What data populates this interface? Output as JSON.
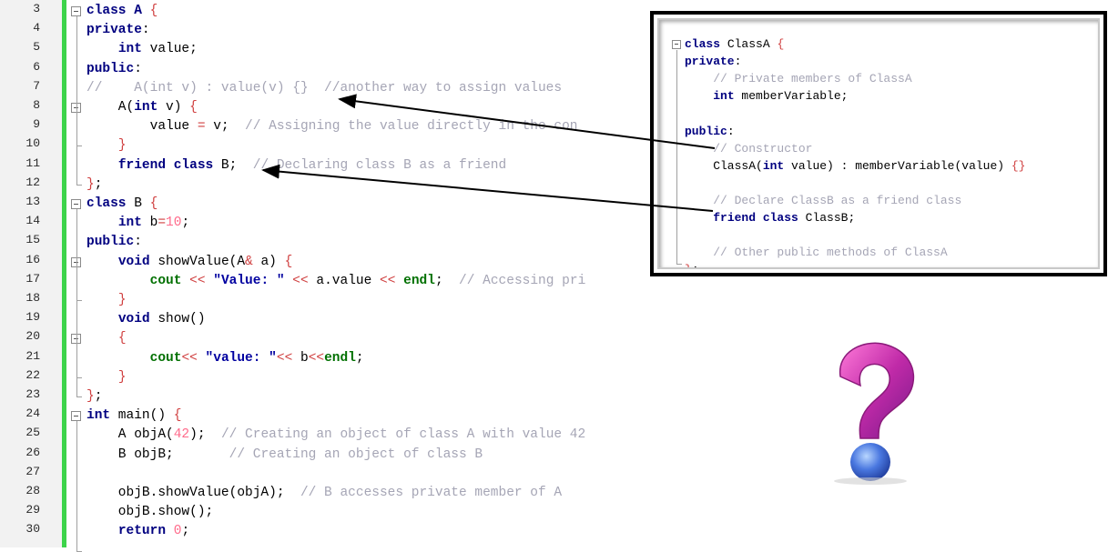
{
  "editor": {
    "line_numbers": [
      "3",
      "4",
      "5",
      "6",
      "7",
      "8",
      "9",
      "10",
      "11",
      "12",
      "13",
      "14",
      "15",
      "16",
      "17",
      "18",
      "19",
      "20",
      "21",
      "22",
      "23",
      "24",
      "25",
      "26",
      "27",
      "28",
      "29",
      "30"
    ],
    "lines": [
      [
        {
          "t": "class A ",
          "c": "kw"
        },
        {
          "t": "{",
          "c": "br"
        }
      ],
      [
        {
          "t": "private",
          "c": "kw"
        },
        {
          "t": ":",
          "c": ""
        }
      ],
      [
        {
          "t": "    ",
          "c": ""
        },
        {
          "t": "int",
          "c": "kw"
        },
        {
          "t": " value;",
          "c": ""
        }
      ],
      [
        {
          "t": "public",
          "c": "kw"
        },
        {
          "t": ":",
          "c": ""
        }
      ],
      [
        {
          "t": "//    A(int v) : value(v) {}  //another way to assign values",
          "c": "cm"
        }
      ],
      [
        {
          "t": "    A(",
          "c": ""
        },
        {
          "t": "int",
          "c": "kw"
        },
        {
          "t": " v) ",
          "c": ""
        },
        {
          "t": "{",
          "c": "br"
        }
      ],
      [
        {
          "t": "        value ",
          "c": ""
        },
        {
          "t": "=",
          "c": "op"
        },
        {
          "t": " v;  ",
          "c": ""
        },
        {
          "t": "// Assigning the value directly in the con",
          "c": "cm"
        }
      ],
      [
        {
          "t": "    ",
          "c": ""
        },
        {
          "t": "}",
          "c": "br"
        }
      ],
      [
        {
          "t": "    ",
          "c": ""
        },
        {
          "t": "friend class",
          "c": "kw"
        },
        {
          "t": " B;  ",
          "c": ""
        },
        {
          "t": "// Declaring class B as a friend",
          "c": "cm"
        }
      ],
      [
        {
          "t": "}",
          "c": "br"
        },
        {
          "t": ";",
          "c": ""
        }
      ],
      [
        {
          "t": "class",
          "c": "kw"
        },
        {
          "t": " B ",
          "c": ""
        },
        {
          "t": "{",
          "c": "br"
        }
      ],
      [
        {
          "t": "    ",
          "c": ""
        },
        {
          "t": "int",
          "c": "kw"
        },
        {
          "t": " b",
          "c": ""
        },
        {
          "t": "=",
          "c": "op"
        },
        {
          "t": "10",
          "c": "num"
        },
        {
          "t": ";",
          "c": ""
        }
      ],
      [
        {
          "t": "public",
          "c": "kw"
        },
        {
          "t": ":",
          "c": ""
        }
      ],
      [
        {
          "t": "    ",
          "c": ""
        },
        {
          "t": "void",
          "c": "kw"
        },
        {
          "t": " showValue(A",
          "c": ""
        },
        {
          "t": "&",
          "c": "op"
        },
        {
          "t": " a) ",
          "c": ""
        },
        {
          "t": "{",
          "c": "br"
        }
      ],
      [
        {
          "t": "        ",
          "c": ""
        },
        {
          "t": "cout",
          "c": "fn"
        },
        {
          "t": " << ",
          "c": "op"
        },
        {
          "t": "\"Value: \"",
          "c": "str"
        },
        {
          "t": " << ",
          "c": "op"
        },
        {
          "t": "a.value ",
          "c": ""
        },
        {
          "t": "<<",
          "c": "op"
        },
        {
          "t": " endl",
          "c": "fn"
        },
        {
          "t": ";  ",
          "c": ""
        },
        {
          "t": "// Accessing pri",
          "c": "cm"
        }
      ],
      [
        {
          "t": "    ",
          "c": ""
        },
        {
          "t": "}",
          "c": "br"
        }
      ],
      [
        {
          "t": "    ",
          "c": ""
        },
        {
          "t": "void",
          "c": "kw"
        },
        {
          "t": " show()",
          "c": ""
        }
      ],
      [
        {
          "t": "    ",
          "c": ""
        },
        {
          "t": "{",
          "c": "br"
        }
      ],
      [
        {
          "t": "        ",
          "c": ""
        },
        {
          "t": "cout",
          "c": "fn"
        },
        {
          "t": "<< ",
          "c": "op"
        },
        {
          "t": "\"value: \"",
          "c": "str"
        },
        {
          "t": "<<",
          "c": "op"
        },
        {
          "t": " b",
          "c": ""
        },
        {
          "t": "<<",
          "c": "op"
        },
        {
          "t": "endl",
          "c": "fn"
        },
        {
          "t": ";",
          "c": ""
        }
      ],
      [
        {
          "t": "    ",
          "c": ""
        },
        {
          "t": "}",
          "c": "br"
        }
      ],
      [
        {
          "t": "}",
          "c": "br"
        },
        {
          "t": ";",
          "c": ""
        }
      ],
      [
        {
          "t": "int",
          "c": "kw"
        },
        {
          "t": " main() ",
          "c": ""
        },
        {
          "t": "{",
          "c": "br"
        }
      ],
      [
        {
          "t": "    A objA(",
          "c": ""
        },
        {
          "t": "42",
          "c": "num"
        },
        {
          "t": ");  ",
          "c": ""
        },
        {
          "t": "// Creating an object of class A with value 42",
          "c": "cm"
        }
      ],
      [
        {
          "t": "    B objB;       ",
          "c": ""
        },
        {
          "t": "// Creating an object of class B",
          "c": "cm"
        }
      ],
      [
        {
          "t": "",
          "c": ""
        }
      ],
      [
        {
          "t": "    objB.showValue(objA);  ",
          "c": ""
        },
        {
          "t": "// B accesses private member of A",
          "c": "cm"
        }
      ],
      [
        {
          "t": "    objB.show();",
          "c": ""
        }
      ],
      [
        {
          "t": "    ",
          "c": ""
        },
        {
          "t": "return",
          "c": "kw"
        },
        {
          "t": " ",
          "c": ""
        },
        {
          "t": "0",
          "c": "num"
        },
        {
          "t": ";",
          "c": ""
        }
      ]
    ]
  },
  "inset": {
    "lines": [
      [
        {
          "t": "class",
          "c": "kw"
        },
        {
          "t": " ClassA ",
          "c": ""
        },
        {
          "t": "{",
          "c": "br"
        }
      ],
      [
        {
          "t": "private",
          "c": "kw"
        },
        {
          "t": ":",
          "c": ""
        }
      ],
      [
        {
          "t": "    // Private members of ClassA",
          "c": "cm"
        }
      ],
      [
        {
          "t": "    ",
          "c": ""
        },
        {
          "t": "int",
          "c": "kw"
        },
        {
          "t": " memberVariable;",
          "c": ""
        }
      ],
      [
        {
          "t": "",
          "c": ""
        }
      ],
      [
        {
          "t": "public",
          "c": "kw"
        },
        {
          "t": ":",
          "c": ""
        }
      ],
      [
        {
          "t": "    // Constructor",
          "c": "cm"
        }
      ],
      [
        {
          "t": "    ClassA(",
          "c": ""
        },
        {
          "t": "int",
          "c": "kw"
        },
        {
          "t": " value) : memberVariable(value) ",
          "c": ""
        },
        {
          "t": "{}",
          "c": "br"
        }
      ],
      [
        {
          "t": "",
          "c": ""
        }
      ],
      [
        {
          "t": "    // Declare ClassB as a friend class",
          "c": "cm"
        }
      ],
      [
        {
          "t": "    ",
          "c": ""
        },
        {
          "t": "friend class",
          "c": "kw"
        },
        {
          "t": " ClassB;",
          "c": ""
        }
      ],
      [
        {
          "t": "",
          "c": ""
        }
      ],
      [
        {
          "t": "    // Other public methods of ClassA",
          "c": "cm"
        }
      ],
      [
        {
          "t": "}",
          "c": "br"
        },
        {
          "t": ";",
          "c": ""
        }
      ]
    ]
  },
  "icons": {
    "question_mark": "question-mark-icon"
  }
}
